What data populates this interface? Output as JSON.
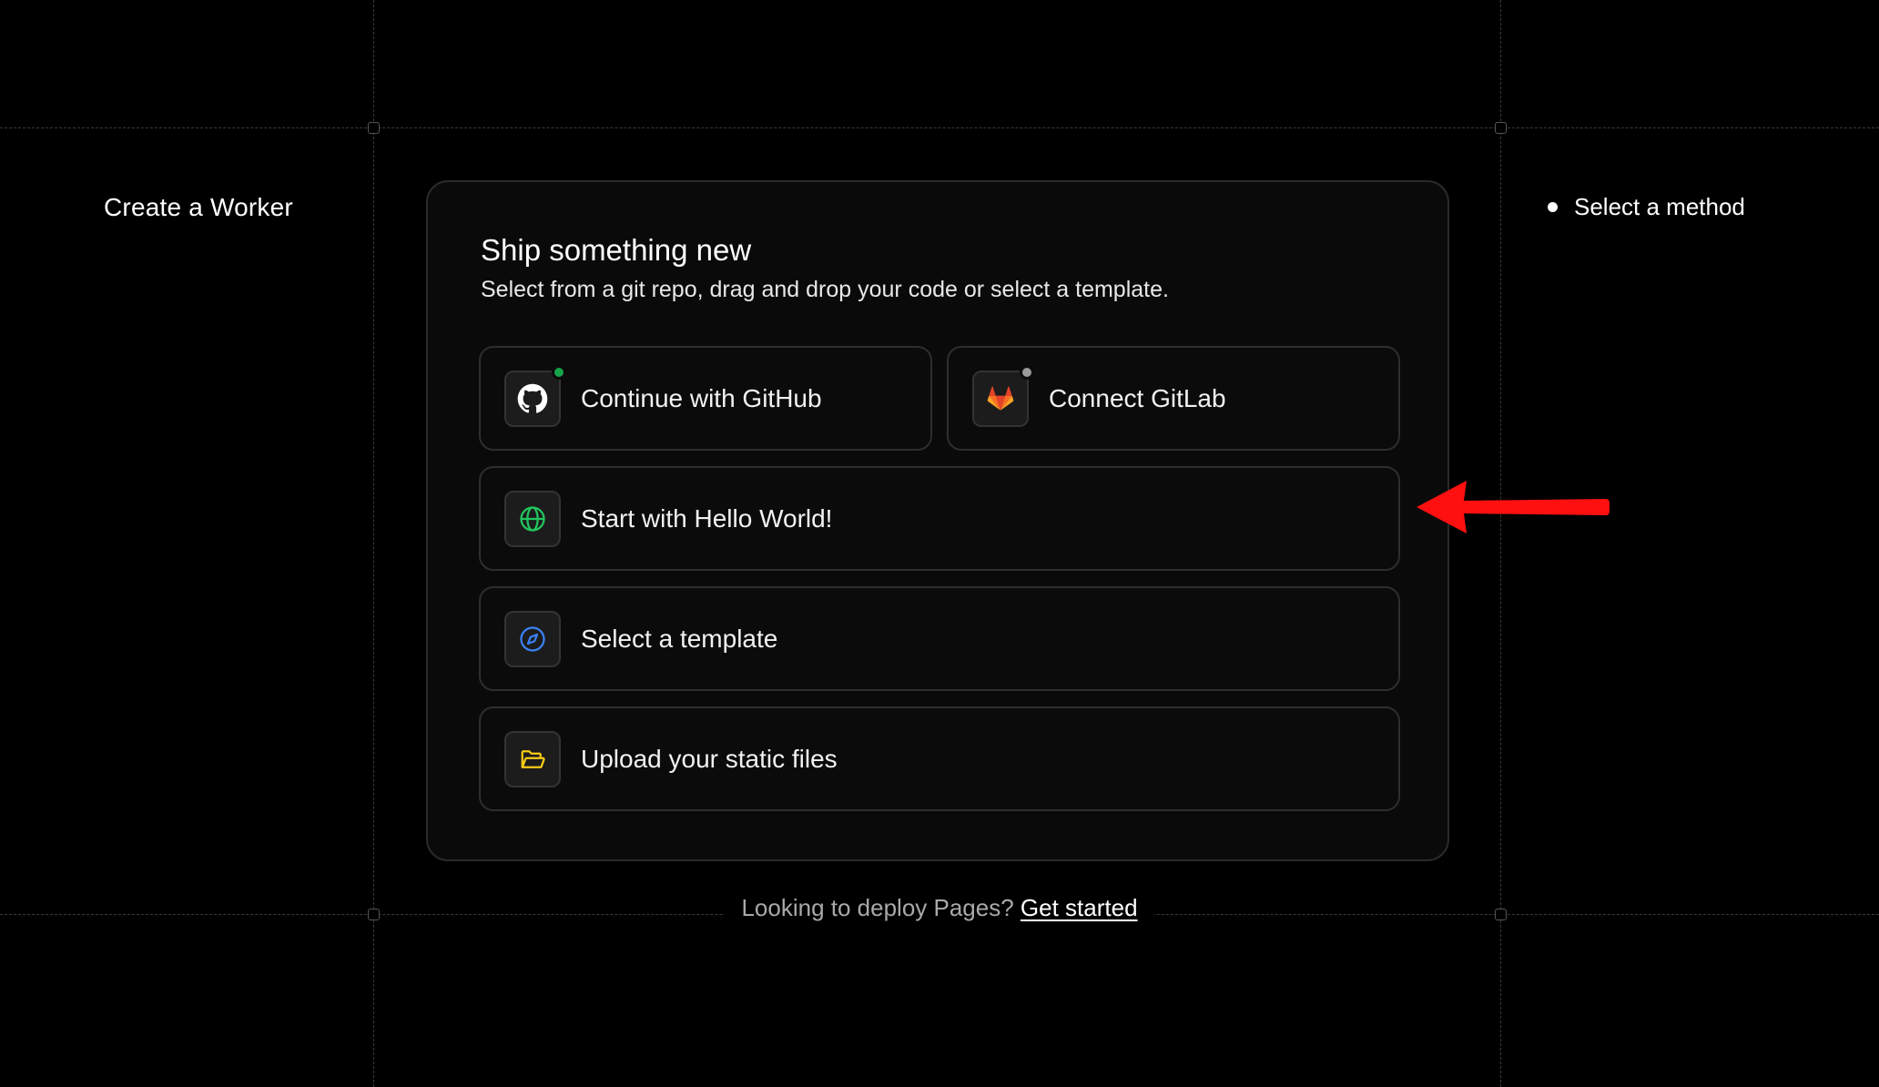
{
  "page": {
    "left_title": "Create a Worker",
    "steps": [
      {
        "label": "Select a method",
        "active": true
      }
    ]
  },
  "card": {
    "title": "Ship something new",
    "subtitle": "Select from a git repo, drag and drop your code or select a template.",
    "options": {
      "github": {
        "label": "Continue with GitHub",
        "icon": "github-icon",
        "status_color": "#16a34a"
      },
      "gitlab": {
        "label": "Connect GitLab",
        "icon": "gitlab-icon",
        "status_color": "#9a9a9a"
      },
      "hello_world": {
        "label": "Start with Hello World!",
        "icon": "globe-icon",
        "icon_color": "#22c55e"
      },
      "template": {
        "label": "Select a template",
        "icon": "compass-icon",
        "icon_color": "#3b82f6"
      },
      "upload": {
        "label": "Upload your static files",
        "icon": "folder-open-icon",
        "icon_color": "#facc15"
      }
    }
  },
  "footer": {
    "prompt": "Looking to deploy Pages?",
    "link": "Get started"
  },
  "annotation": {
    "arrow_color": "#ff1010",
    "icon": "red-arrow-icon"
  },
  "colors": {
    "background": "#000000",
    "card_bg": "#0a0a0a",
    "border": "#2e2e2e"
  }
}
